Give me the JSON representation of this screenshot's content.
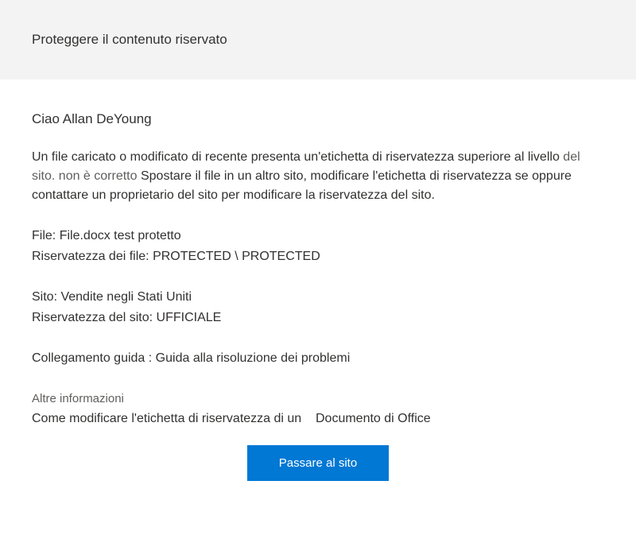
{
  "header": {
    "title": "Proteggere il contenuto riservato"
  },
  "body": {
    "greeting": "Ciao Allan DeYoung",
    "paragraph_part1": "Un file caricato o modificato di recente presenta un'etichetta di riservatezza superiore al livello",
    "paragraph_part2": "del sito. non è corretto",
    "paragraph_part3": "Spostare il file in un altro sito, modificare l'etichetta di riservatezza se oppure contattare un proprietario del sito per modificare la riservatezza del sito.",
    "file_label": "File:",
    "file_value": "File.docx test protetto",
    "file_sensitivity_label": "Riservatezza dei file:",
    "file_sensitivity_value": "PROTECTED \\ PROTECTED",
    "site_label": "Sito:",
    "site_value": "Vendite negli Stati Uniti",
    "site_sensitivity_label": "Riservatezza del sito:",
    "site_sensitivity_value": "UFFICIALE",
    "help_link_label": "Collegamento guida :",
    "help_link_value": "Guida alla risoluzione dei problemi",
    "more_info_title": "Altre informazioni",
    "more_info_text1": "Come modificare l'etichetta di riservatezza di un",
    "more_info_text2": "Documento di Office",
    "button_label": "Passare al sito"
  }
}
